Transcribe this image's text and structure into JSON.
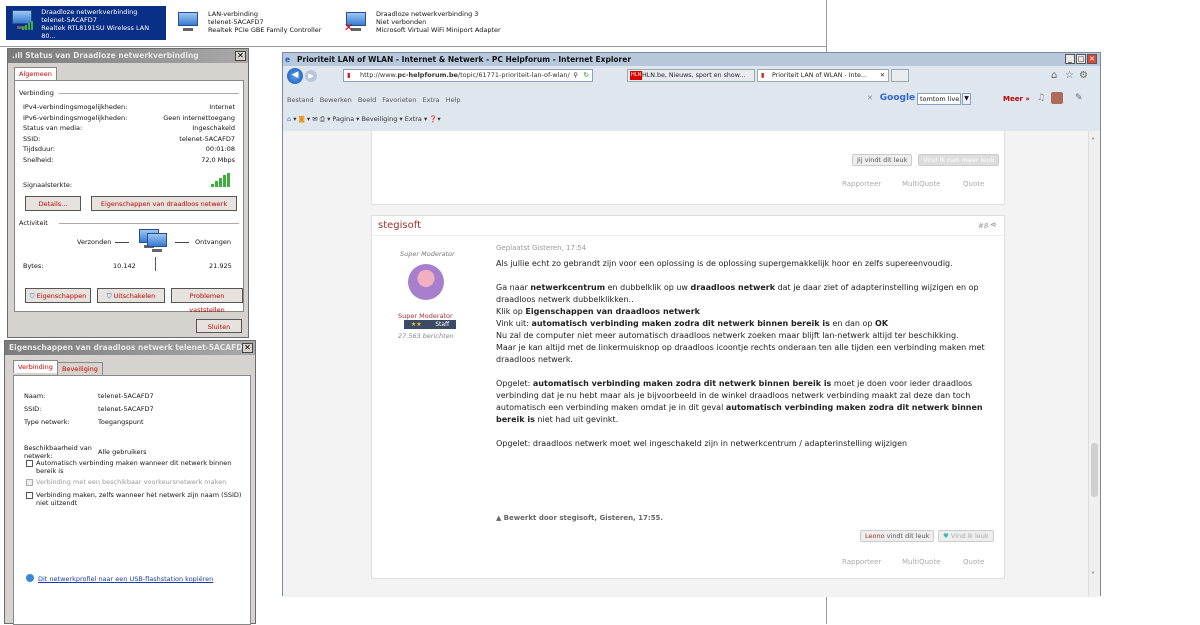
{
  "connections": [
    {
      "title": "Draadloze netwerkverbinding",
      "line2": "telenet-5ACAFD7",
      "line3": "Realtek RTL8191SU Wireless LAN 80..."
    },
    {
      "title": "LAN-verbinding",
      "line2": "telenet-5ACAFD7",
      "line3": "Realtek PCIe GBE Family Controller"
    },
    {
      "title": "Draadloze netwerkverbinding 3",
      "line2": "Niet verbonden",
      "line3": "Microsoft Virtual WiFi Miniport Adapter"
    }
  ],
  "status_dialog": {
    "title": "Status van Draadloze netwerkverbinding",
    "tab": "Algemeen",
    "group_conn": "Verbinding",
    "rows": [
      {
        "k": "IPv4-verbindingsmogelijkheden:",
        "v": "Internet"
      },
      {
        "k": "IPv6-verbindingsmogelijkheden:",
        "v": "Geen internettoegang"
      },
      {
        "k": "Status van media:",
        "v": "Ingeschakeld"
      },
      {
        "k": "SSID:",
        "v": "telenet-5ACAFD7"
      },
      {
        "k": "Tijdsduur:",
        "v": "00:01:08"
      },
      {
        "k": "Snelheid:",
        "v": "72,0 Mbps"
      }
    ],
    "signal_label": "Signaalsterkte:",
    "details_btn": "Details...",
    "props_wireless_btn": "Eigenschappen van draadloos netwerk",
    "group_activity": "Activiteit",
    "sent": "Verzonden",
    "received": "Ontvangen",
    "bytes_label": "Bytes:",
    "bytes_sent": "10.142",
    "bytes_recv": "21.925",
    "btn_props": "Eigenschappen",
    "btn_disable": "Uitschakelen",
    "btn_diagnose": "Problemen vaststellen",
    "btn_close": "Sluiten"
  },
  "props_dialog": {
    "title": "Eigenschappen van draadloos netwerk telenet-5ACAFD7",
    "tab1": "Verbinding",
    "tab2": "Beveiliging",
    "rows": [
      {
        "k": "Naam:",
        "v": "telenet-5ACAFD7"
      },
      {
        "k": "SSID:",
        "v": "telenet-5ACAFD7"
      },
      {
        "k": "Type netwerk:",
        "v": "Toegangspunt"
      }
    ],
    "avail_k": "Beschikbaarheid van netwerk:",
    "avail_v": "Alle gebruikers",
    "chk1": "Automatisch verbinding maken wanneer dit netwerk binnen bereik is",
    "chk2": "Verbinding met een beschikbaar voorkeursnetwerk maken",
    "chk3": "Verbinding maken, zelfs wanneer het netwerk zijn naam (SSID) niet uitzendt",
    "usb_link": "Dit netwerkprofiel naar een USB-flashstation kopiëren"
  },
  "browser": {
    "title": "Prioriteit LAN of WLAN - Internet & Netwerk - PC Helpforum - Internet Explorer",
    "url_prefix": "http://www.",
    "url_domain": "pc-helpforum.be",
    "url_rest": "/topic/61771-prioriteit-lan-of-wlan/",
    "tab1": "HLN.be, Nieuws, sport en show...",
    "tab2": "Prioriteit LAN of WLAN - Inte...",
    "menu": "Bestand  Bewerken  Beeld  Favorieten  Extra  Help",
    "toolbar": "Pagina ▾   Beveiliging ▾   Extra ▾",
    "google": "Google",
    "search_value": "tomtom live",
    "meer": "Meer »"
  },
  "post_prev": {
    "likes_self": "Jij vindt dit leuk",
    "unlike": "Vind ik niet meer leuk",
    "report": "Rapporteer",
    "multiquote": "MultiQuote",
    "quote": "Quote"
  },
  "post": {
    "author": "stegisoft",
    "num": "#8",
    "role": "Super Moderator",
    "role2": "Super Moderator",
    "badge_stars": "★★",
    "badge": "Staff",
    "posts": "27.563 berichten",
    "posted": "Geplaatst Gisteren, 17:54",
    "p1": "Als jullie echt zo gebrandt zijn voor een oplossing is de oplossing supergemakkelijk hoor en zelfs supereenvoudig.",
    "p2a": "Ga naar ",
    "p2b": "netwerkcentrum",
    "p2c": " en dubbelklik op uw ",
    "p2d": "draadloos netwerk",
    "p2e": " dat je daar ziet of adapterinstelling wijzigen en op draadloos netwerk dubbelklikken..",
    "p3a": "Klik op ",
    "p3b": "Eigenschappen van draadloos netwerk",
    "p4a": "Vink uit: ",
    "p4b": "automatisch verbinding maken zodra dit netwerk binnen bereik is",
    "p4c": " en dan op ",
    "p4d": "OK",
    "p5": "Nu zal de computer niet meer automatisch draadloos netwerk zoeken maar blijft lan-netwerk altijd ter beschikking.",
    "p6": "Maar je kan altijd met de linkermuisknop op draadloos icoontje rechts onderaan ten alle tijden een verbinding maken met draadloos netwerk.",
    "p7a": "Opgelet: ",
    "p7b": "automatisch verbinding maken zodra dit netwerk binnen bereik is",
    "p7c": " moet je doen voor ieder draadloos verbinding dat je nu hebt maar als je bijvoorbeeld in de winkel draadloos netwerk verbinding maakt zal deze dan toch automatisch een verbinding maken omdat je in dit geval ",
    "p7d": "automatisch verbinding maken zodra dit netwerk binnen bereik is",
    "p7e": " niet had uit gevinkt.",
    "p8": "Opgelet: draadloos netwerk moet wel ingeschakeld zijn in netwerkcentrum / adapterinstelling wijzigen",
    "edited": "Bewerkt door stegisoft, Gisteren, 17:55.",
    "liker": "Leono",
    "liker_suffix": " vindt dit leuk",
    "like_btn": "Vind ik leuk",
    "report": "Rapporteer",
    "multiquote": "MultiQuote",
    "quote": "Quote"
  },
  "colors": {
    "accent": "#a0312b",
    "selection": "#0a2f87"
  }
}
